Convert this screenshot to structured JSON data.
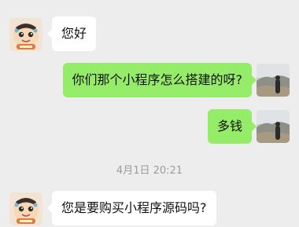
{
  "header_partial": "",
  "messages": [
    {
      "side": "in",
      "text": "您好"
    },
    {
      "side": "out",
      "text": "你们那个小程序怎么搭建的呀?"
    },
    {
      "side": "out",
      "text": "多钱"
    },
    {
      "side": "in",
      "text": "您是要购买小程序源码吗?"
    }
  ],
  "timestamp": "4月1日 20:21",
  "colors": {
    "background": "#ededed",
    "incoming_bubble": "#ffffff",
    "outgoing_bubble": "#95ec69",
    "timestamp_text": "#9c9c9c"
  },
  "icons": {
    "contact_avatar": "cartoon-character-avatar",
    "self_avatar": "landscape-photo-avatar"
  }
}
